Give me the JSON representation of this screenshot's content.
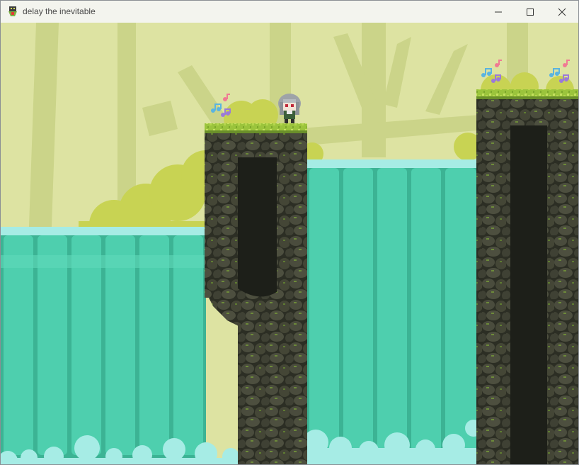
{
  "window": {
    "title": "delay the inevitable",
    "icon": "game-logo-icon",
    "controls": {
      "minimize": "minimize-icon",
      "maximize": "maximize-icon",
      "close": "close-icon"
    }
  },
  "scene": {
    "colors": {
      "sky": "#dde3a2",
      "trees": "#cbd489",
      "bushes": "#c8d353",
      "water": "#4ecfae",
      "water_dark": "#3cb394",
      "foam": "#a6ece5",
      "rock": "#3f4134",
      "cave": "#1d1f19",
      "grass": "#9bc43c"
    },
    "notes_icon": "music-notes-icon",
    "character_icon": "player-character-icon"
  }
}
